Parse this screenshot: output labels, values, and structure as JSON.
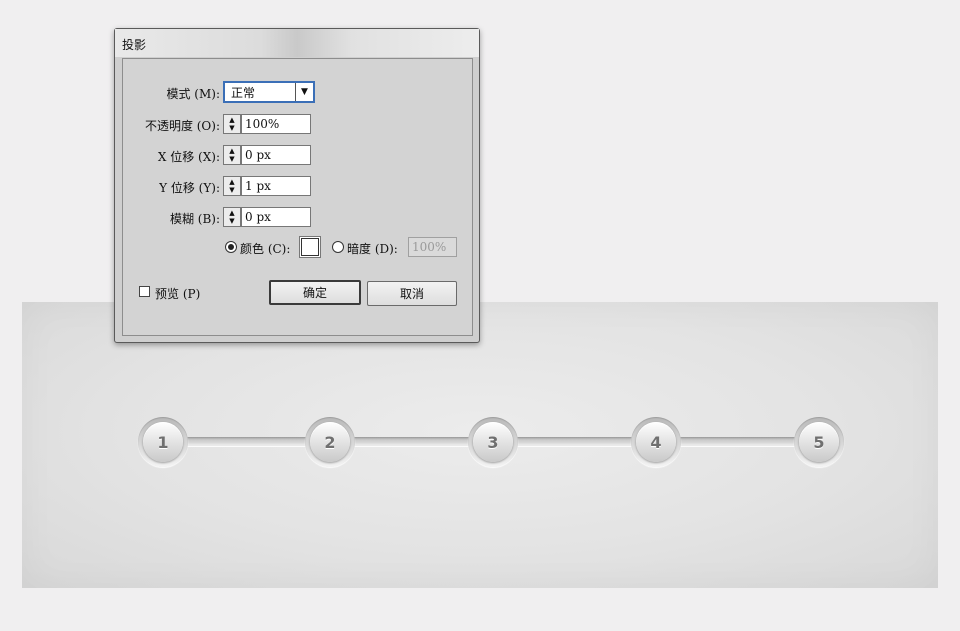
{
  "dialog": {
    "title": "投影",
    "mode_label": "模式 (M):",
    "mode_value": "正常",
    "opacity_label": "不透明度 (O):",
    "opacity_value": "100%",
    "x_offset_label": "X 位移 (X):",
    "x_offset_value": "0 px",
    "y_offset_label": "Y 位移 (Y):",
    "y_offset_value": "1 px",
    "blur_label": "模糊 (B):",
    "blur_value": "0 px",
    "color_label": "颜色 (C):",
    "color_selected": true,
    "color_value": "#ffffff",
    "darkness_label": "暗度 (D):",
    "darkness_value": "100%",
    "preview_label": "预览 (P)",
    "preview_checked": false,
    "ok_label": "确定",
    "cancel_label": "取消"
  },
  "stepper": {
    "steps": [
      "1",
      "2",
      "3",
      "4",
      "5"
    ]
  },
  "icons": {
    "dropdown": "chevron-down-icon",
    "spinner": "spin-arrows-icon"
  }
}
